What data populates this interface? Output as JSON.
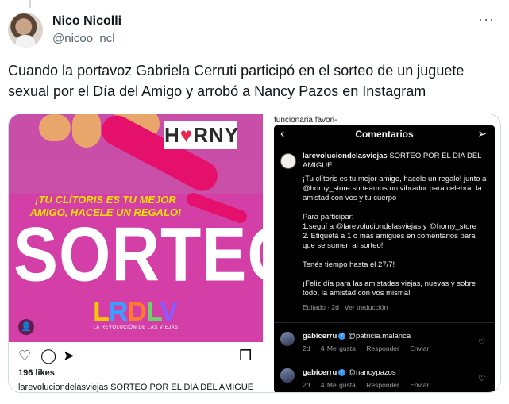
{
  "tweet": {
    "display_name": "Nico Nicolli",
    "handle": "@nicoo_ncl",
    "more_icon": "more-icon",
    "text": "Cuando la portavoz Gabriela Cerruti participó en el sorteo de un juguete sexual por el Día del Amigo y arrobó a Nancy Pazos en Instagram"
  },
  "left_post": {
    "brand_logo": "HORNY",
    "claim": "¡TU CLÍTORIS ES TU MEJOR AMIGO, HACELE UN REGALO!",
    "headline": "SORTEO",
    "logo_letters": [
      "L",
      "R",
      "D",
      "L",
      "V"
    ],
    "logo_sub": "LA REVOLUCIÓN DE LAS VIEJAS",
    "likes": "196 likes",
    "caption": "larevoluciondelasviejas SORTEO POR EL DIA DEL AMIGUE",
    "colors": {
      "background": "#d43ea7",
      "toy": "#e5106b",
      "claim": "#f5e000"
    }
  },
  "right_post": {
    "above_caption": "funcionaria favori-",
    "header_title": "Comentarios",
    "post_author": "larevoluciondelasviejas",
    "post_title": "SORTEO POR EL DIA DEL AMIGUE",
    "body": [
      "¡Tu clítoris es tu mejor amigo, hacele un regalo! junto a @horny_store sorteamos un vibrador para celebrar la amistad con vos y tu cuerpo",
      "Para participar:\n1.seguí a @larevoluciondelasviejas y @horny_store\n2. Etiquetá a 1 o más amigues en comentarios para que se sumen al sorteo!",
      "Tenés tiempo hasta el 27/7!",
      "¡Feliz día para las amistades viejas, nuevas y sobre todo, la amistad con vos misma!"
    ],
    "post_meta": "Editado · 2d   Ver traducción",
    "comments": [
      {
        "user": "gabicerru",
        "mention": "@patricia.malanca",
        "age": "2d",
        "likes": "4 Me gusta",
        "reply": "Responder",
        "send": "Enviar"
      },
      {
        "user": "gabicerru",
        "mention": "@nancypazos",
        "age": "2d",
        "likes": "4 Me gusta",
        "reply": "Responder",
        "send": "Enviar"
      }
    ]
  }
}
